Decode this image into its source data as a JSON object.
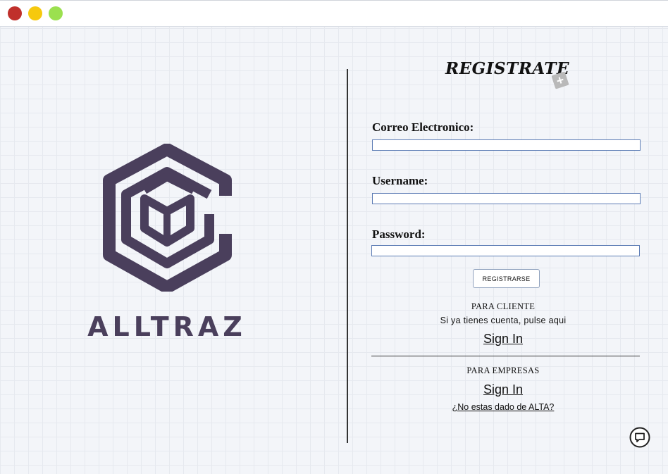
{
  "window": {
    "controls": [
      "close",
      "minimize",
      "maximize"
    ]
  },
  "brand": {
    "name": "ALLTRAZ",
    "logo_icon": "hexagon-cube-logo",
    "color": "#4a3f5c"
  },
  "form": {
    "title": "REGISTRATE",
    "title_icon": "plus-icon",
    "email_label": "Correo Electronico:",
    "email_value": "",
    "username_label": "Username:",
    "username_value": "",
    "password_label": "Password:",
    "password_value": "",
    "submit_label": "REGISTRARSE"
  },
  "client": {
    "heading": "PARA CLIENTE",
    "hint": "Si ya tienes cuenta, pulse aqui",
    "signin_label": "Sign In"
  },
  "business": {
    "heading": "PARA EMPRESAS",
    "signin_label": "Sign In",
    "alta_link": "¿No estas dado de ALTA?"
  },
  "chat": {
    "icon": "chat-bubble-icon"
  },
  "colors": {
    "close": "#c0302b",
    "minimize": "#f6c90e",
    "maximize": "#9be04f",
    "input_border": "#5b7bb4"
  }
}
